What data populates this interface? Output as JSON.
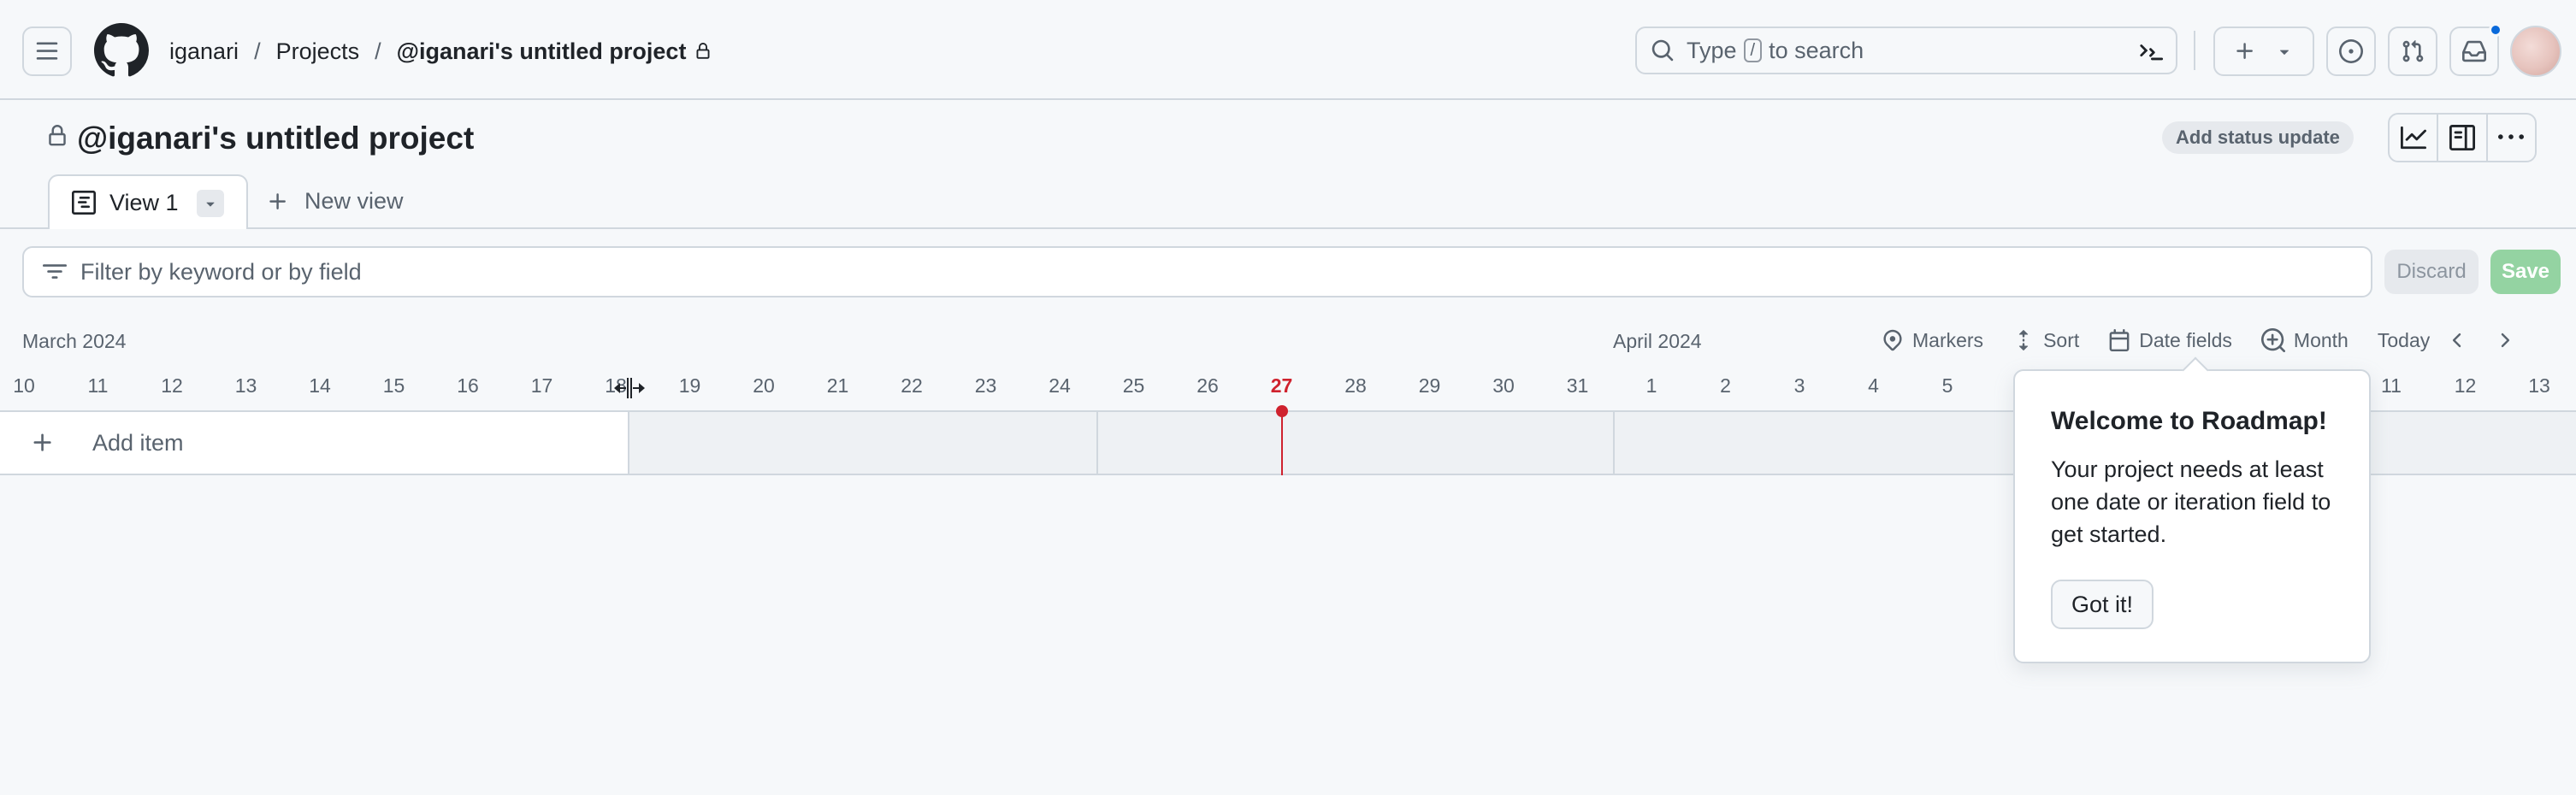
{
  "header": {
    "breadcrumb": {
      "owner": "iganari",
      "separator": "/",
      "projects": "Projects",
      "project": "@iganari's untitled project"
    },
    "search": {
      "prefix": "Type",
      "key": "/",
      "suffix": "to search"
    },
    "notification_dot_color": "#0969da",
    "icons": [
      "hamburger-icon",
      "github-logo",
      "lock-icon",
      "search-icon",
      "command-palette-icon",
      "plus-icon",
      "triangle-down-icon",
      "issue-icon",
      "pull-request-icon",
      "inbox-icon"
    ]
  },
  "project": {
    "title": "@iganari's untitled project",
    "status_button": "Add status update",
    "actions": [
      "insights-icon",
      "sidebar-icon",
      "kebab-horizontal-icon"
    ]
  },
  "tabs": {
    "active": "View 1",
    "new_view": "New view"
  },
  "filter": {
    "placeholder": "Filter by keyword or by field",
    "discard": "Discard",
    "save": "Save"
  },
  "roadmap": {
    "months": [
      "March 2024",
      "April 2024"
    ],
    "toolbar": {
      "markers": "Markers",
      "sort": "Sort",
      "date_fields": "Date fields",
      "zoom": "Month",
      "today": "Today"
    },
    "days": [
      "10",
      "11",
      "12",
      "13",
      "14",
      "15",
      "16",
      "17",
      "18",
      "19",
      "20",
      "21",
      "22",
      "23",
      "24",
      "25",
      "26",
      "27",
      "28",
      "29",
      "30",
      "31",
      "1",
      "2",
      "3",
      "4",
      "5",
      "11",
      "12",
      "13"
    ],
    "today": "27",
    "today_color": "#cf222e",
    "add_item": "Add item"
  },
  "popover": {
    "title": "Welcome to Roadmap!",
    "body": "Your project needs at least one date or iteration field to get started.",
    "button": "Got it!"
  },
  "colors": {
    "border": "#d0d7de",
    "muted_text": "#59636e",
    "save_button": "#94d3a2"
  }
}
